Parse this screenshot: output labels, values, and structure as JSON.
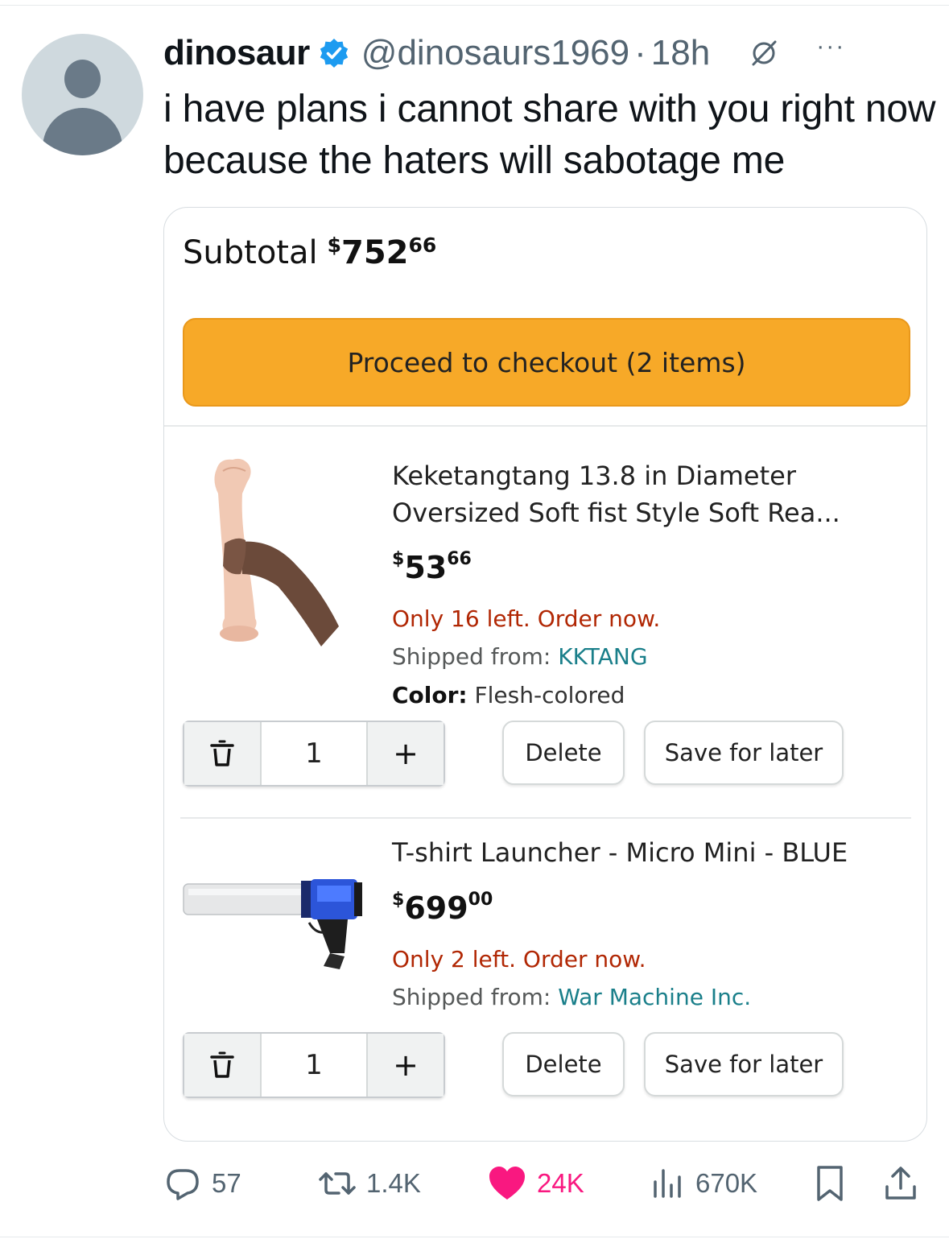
{
  "tweet": {
    "author_name": "dinosaur",
    "author_handle": "@dinosaurs1969",
    "separator": "·",
    "time": "18h",
    "more_label": "···",
    "text": "i have plans i cannot share with you right now because the haters will sabotage me"
  },
  "cart": {
    "subtotal_label": "Subtotal",
    "subtotal_currency": "$",
    "subtotal_whole": "752",
    "subtotal_fraction": "66",
    "checkout_label": "Proceed to checkout (2 items)",
    "items": [
      {
        "title": "Keketangtang 13.8 in Diameter Oversized Soft fist Style Soft Rea...",
        "price_currency": "$",
        "price_whole": "53",
        "price_fraction": "66",
        "stock": "Only 16 left. Order now.",
        "shipped_label": "Shipped from: ",
        "seller": "KKTANG",
        "color_label": "Color:",
        "color_value": " Flesh-colored",
        "quantity": "1",
        "plus_label": "+",
        "delete_label": "Delete",
        "save_label": "Save for later"
      },
      {
        "title": "T-shirt Launcher - Micro Mini - BLUE",
        "price_currency": "$",
        "price_whole": "699",
        "price_fraction": "00",
        "stock": "Only 2 left. Order now.",
        "shipped_label": "Shipped from: ",
        "seller": "War Machine Inc.",
        "quantity": "1",
        "plus_label": "+",
        "delete_label": "Delete",
        "save_label": "Save for later"
      }
    ]
  },
  "actions": {
    "replies": "57",
    "reposts": "1.4K",
    "likes": "24K",
    "views": "670K"
  },
  "colors": {
    "checkout_button": "#f7a928",
    "like_active": "#f91880",
    "verified_badge": "#1d9bf0",
    "stock_warning": "#b12704",
    "seller_link": "#1a7f8a"
  },
  "icons": [
    "verified-badge-icon",
    "grok-icon",
    "more-icon",
    "trash-icon",
    "reply-icon",
    "repost-icon",
    "heart-icon",
    "views-icon",
    "bookmark-icon",
    "share-icon"
  ]
}
